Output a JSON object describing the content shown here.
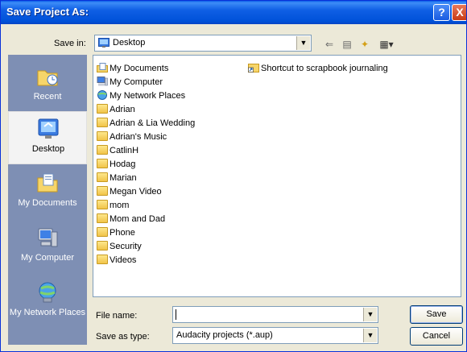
{
  "titlebar": {
    "title": "Save Project As:",
    "help_label": "?",
    "close_label": "X"
  },
  "savein": {
    "label": "Save in:",
    "value": "Desktop"
  },
  "toolbar": {
    "back": "⇐",
    "up": "▤",
    "newfolder": "✦",
    "views": "▦▾"
  },
  "places": [
    {
      "label": "Recent",
      "icon": "recent-folder-icon"
    },
    {
      "label": "Desktop",
      "icon": "desktop-icon"
    },
    {
      "label": "My Documents",
      "icon": "my-documents-icon"
    },
    {
      "label": "My Computer",
      "icon": "my-computer-icon"
    },
    {
      "label": "My Network Places",
      "icon": "network-places-icon"
    }
  ],
  "files_col1": [
    {
      "name": "My Documents",
      "icon": "my-documents-icon"
    },
    {
      "name": "My Computer",
      "icon": "my-computer-icon"
    },
    {
      "name": "My Network Places",
      "icon": "network-places-icon"
    },
    {
      "name": "Adrian",
      "icon": "folder-icon"
    },
    {
      "name": "Adrian & Lia Wedding",
      "icon": "folder-icon"
    },
    {
      "name": "Adrian's Music",
      "icon": "folder-icon"
    },
    {
      "name": "CatlinH",
      "icon": "folder-icon"
    },
    {
      "name": "Hodag",
      "icon": "folder-icon"
    },
    {
      "name": "Marian",
      "icon": "folder-icon"
    },
    {
      "name": "Megan Video",
      "icon": "folder-icon"
    },
    {
      "name": "mom",
      "icon": "folder-icon"
    },
    {
      "name": "Mom and Dad",
      "icon": "folder-icon"
    },
    {
      "name": "Phone",
      "icon": "folder-icon"
    },
    {
      "name": "Security",
      "icon": "folder-icon"
    },
    {
      "name": "Videos",
      "icon": "folder-icon"
    }
  ],
  "files_col2": [
    {
      "name": "Shortcut to scrapbook journaling",
      "icon": "shortcut-folder-icon"
    }
  ],
  "filename": {
    "label": "File name:",
    "value": ""
  },
  "filetype": {
    "label": "Save as type:",
    "value": "Audacity projects (*.aup)"
  },
  "buttons": {
    "save": "Save",
    "cancel": "Cancel"
  },
  "colors": {
    "titlebar": "#0a5ce8",
    "places_bar": "#7e8fb4",
    "dialog_bg": "#ece9d8"
  }
}
